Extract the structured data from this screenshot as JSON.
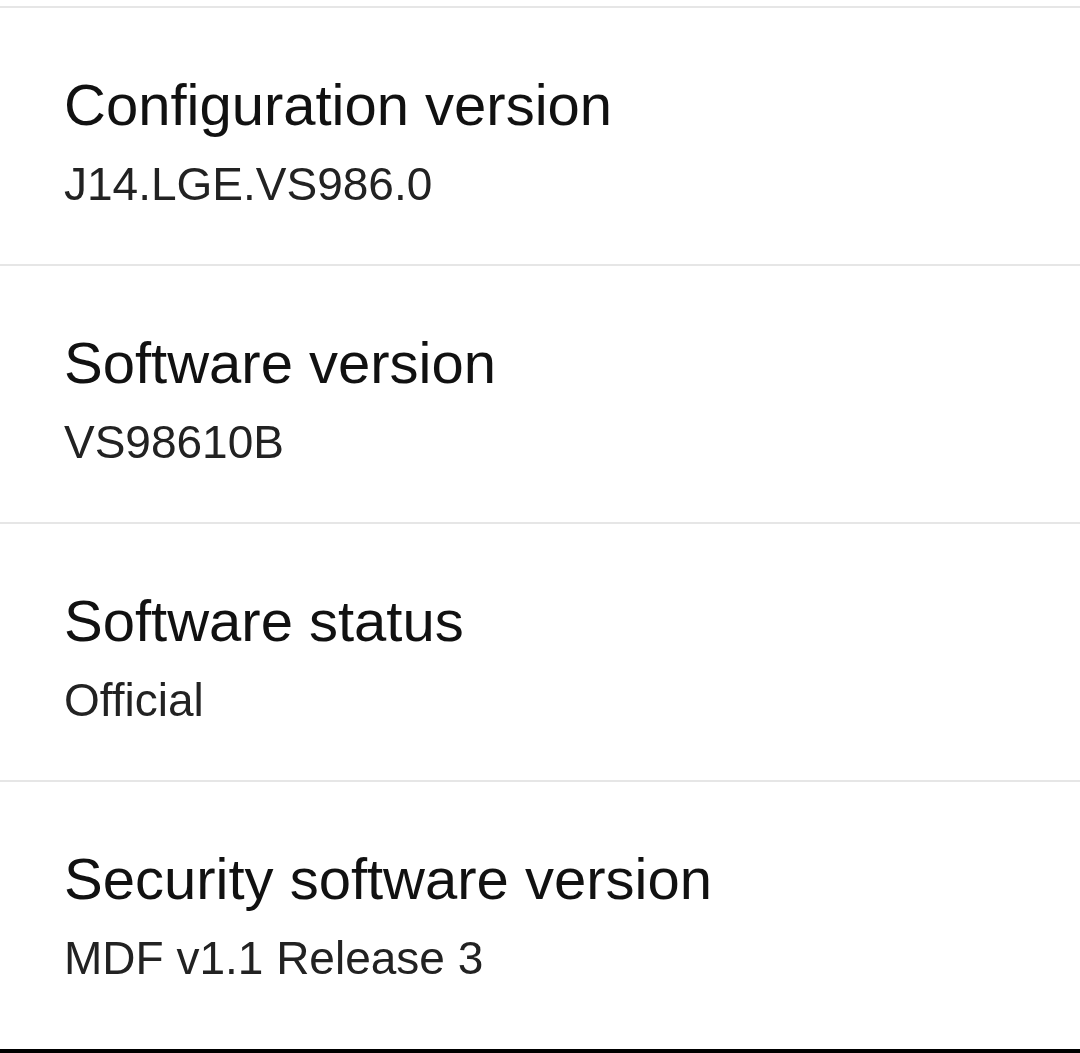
{
  "settings": [
    {
      "title": "Configuration version",
      "value": "J14.LGE.VS986.0"
    },
    {
      "title": "Software version",
      "value": "VS98610B"
    },
    {
      "title": "Software status",
      "value": "Official"
    },
    {
      "title": "Security software version",
      "value": "MDF v1.1 Release 3"
    }
  ]
}
